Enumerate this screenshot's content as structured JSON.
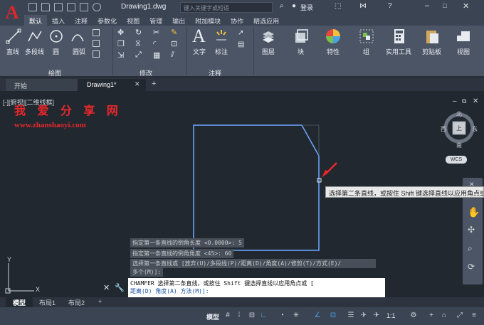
{
  "app": {
    "doc_title": "Drawing1.dwg",
    "search_placeholder": "键入关键字或短语",
    "login": "登录"
  },
  "ribbon_tabs": [
    "默认",
    "插入",
    "注释",
    "参数化",
    "视图",
    "管理",
    "输出",
    "附加模块",
    "协作",
    "精选应用"
  ],
  "ribbon": {
    "draw_buttons": [
      "直线",
      "多段线",
      "圆",
      "圆弧"
    ],
    "text_buttons": [
      "文字",
      "标注"
    ],
    "big_buttons": [
      "图层",
      "块",
      "特性",
      "组",
      "实用工具",
      "剪贴板",
      "视图"
    ],
    "panel_labels": [
      "绘图",
      "修改",
      "注释"
    ]
  },
  "file_tabs": [
    "开始",
    "Drawing1*"
  ],
  "viewport_label": "[-][俯视][二维线框]",
  "watermark": {
    "title": "我 爱 分 享 网",
    "url": "www.zhanshaoyi.com"
  },
  "viewcube": {
    "north": "北",
    "south": "南",
    "west": "西",
    "east": "东",
    "center": "上",
    "wcs": "WCS"
  },
  "tooltip": "选择第二条直线，或按住 Shift 键选择直线以应用角点或",
  "command_history": [
    "指定第一条直线的倒角长度 <0.0000>: 5",
    "指定第一条直线的倒角角度 <45>: 60",
    "选择第一条直线或 [放弃(U)/多段线(P)/距离(D)/角度(A)/修剪(T)/方式(E)/",
    "多个(M)]:"
  ],
  "command_line": {
    "prefix": "CHAMFER 选择第二条直线，或按住 Shift 键选择直线以应用角点或 [",
    "options_line": "距离(D) 角度(A) 方法(M)]:"
  },
  "layout_tabs": [
    "模型",
    "布局1",
    "布局2"
  ],
  "status": {
    "model": "模型",
    "scale": "1:1"
  },
  "colors": {
    "accent": "#4aa3e8",
    "brand_red": "#e0252b",
    "drawing_line": "#6fa8ff"
  }
}
